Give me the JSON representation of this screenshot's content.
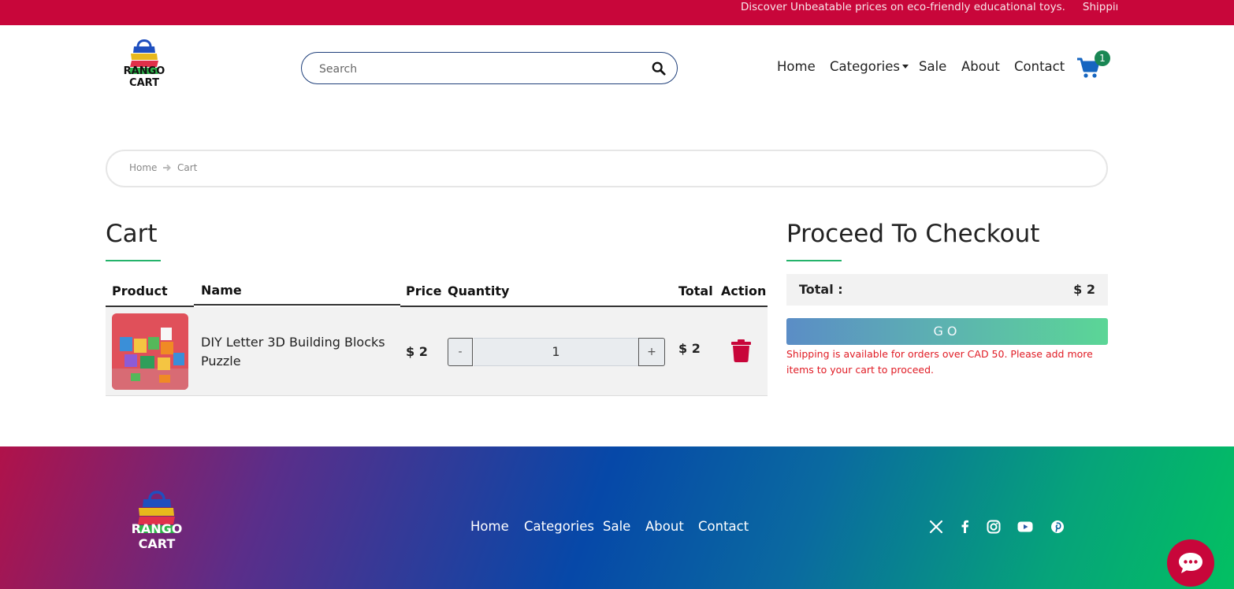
{
  "announcement": {
    "items": [
      "Discover Unbeatable prices on eco-friendly educational toys.",
      "Shipping avai"
    ]
  },
  "header": {
    "logo_text": "RANGO CART",
    "search_placeholder": "Search",
    "nav": [
      "Home",
      "Categories",
      "Sale",
      "About",
      "Contact"
    ],
    "cart_count": "1"
  },
  "breadcrumb": {
    "items": [
      "Home",
      "Cart"
    ]
  },
  "cart": {
    "title": "Cart",
    "columns": [
      "Product",
      "Name",
      "Price",
      "Quantity",
      "Total",
      "Action"
    ],
    "rows": [
      {
        "name": "DIY Letter 3D Building Blocks Puzzle",
        "price": "$ 2",
        "qty_minus": "-",
        "quantity": "1",
        "qty_plus": "+",
        "total": "$ 2"
      }
    ]
  },
  "checkout": {
    "title": "Proceed To Checkout",
    "total_label": "Total :",
    "total_value": "$ 2",
    "go_label": "GO",
    "notice": "Shipping is available for orders over CAD 50. Please add more items to your cart to proceed."
  },
  "footer": {
    "logo_text": "RANGO CART",
    "nav": [
      "Home",
      "Categories",
      "Sale",
      "About",
      "Contact"
    ],
    "social": [
      "x-icon",
      "facebook-icon",
      "instagram-icon",
      "youtube-icon",
      "pinterest-icon"
    ]
  },
  "colors": {
    "brand": "#c8063a",
    "accent_green": "#24b36b",
    "badge": "#198754",
    "cart_blue": "#1565c0",
    "error": "#e01b24"
  }
}
